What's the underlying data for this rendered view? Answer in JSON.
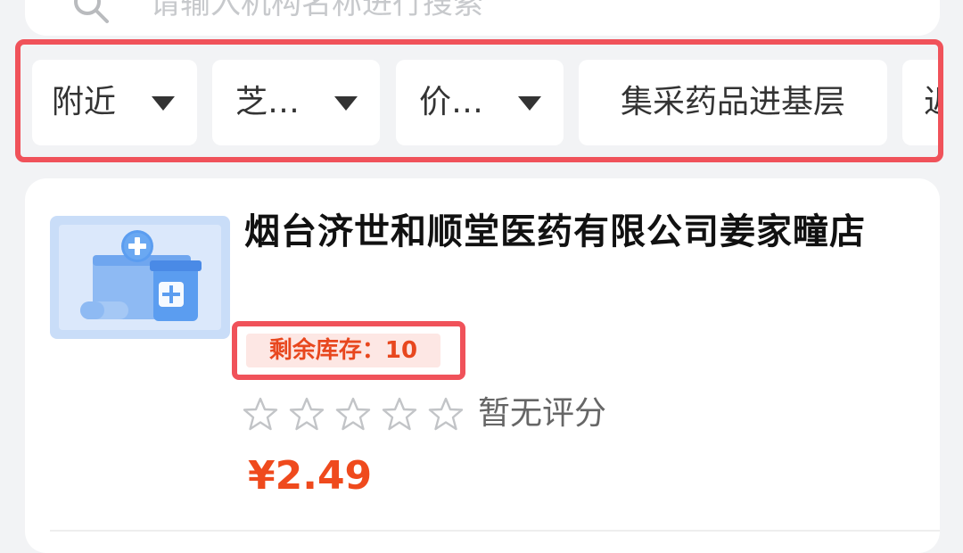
{
  "search": {
    "placeholder": "请输入机构名称进行搜索"
  },
  "filters": [
    {
      "label": "附近",
      "has_dropdown": true
    },
    {
      "label": "芝…",
      "has_dropdown": true
    },
    {
      "label": "价…",
      "has_dropdown": true
    },
    {
      "label": "集采药品进基层",
      "has_dropdown": false
    },
    {
      "label": "近",
      "has_dropdown": false
    }
  ],
  "store": {
    "name": "烟台济世和顺堂医药有限公司姜家疃店",
    "stock_label": "剩余库存：",
    "stock_value": "10",
    "rating_stars_filled": 0,
    "rating_stars_total": 5,
    "rating_text": "暂无评分",
    "price": "¥2.49"
  },
  "colors": {
    "highlight_border": "#f0525a",
    "price": "#ef4a1d",
    "stock_text": "#e8471e",
    "stock_bg": "#fde7e4",
    "thumb_blue": "#5b9df0"
  }
}
